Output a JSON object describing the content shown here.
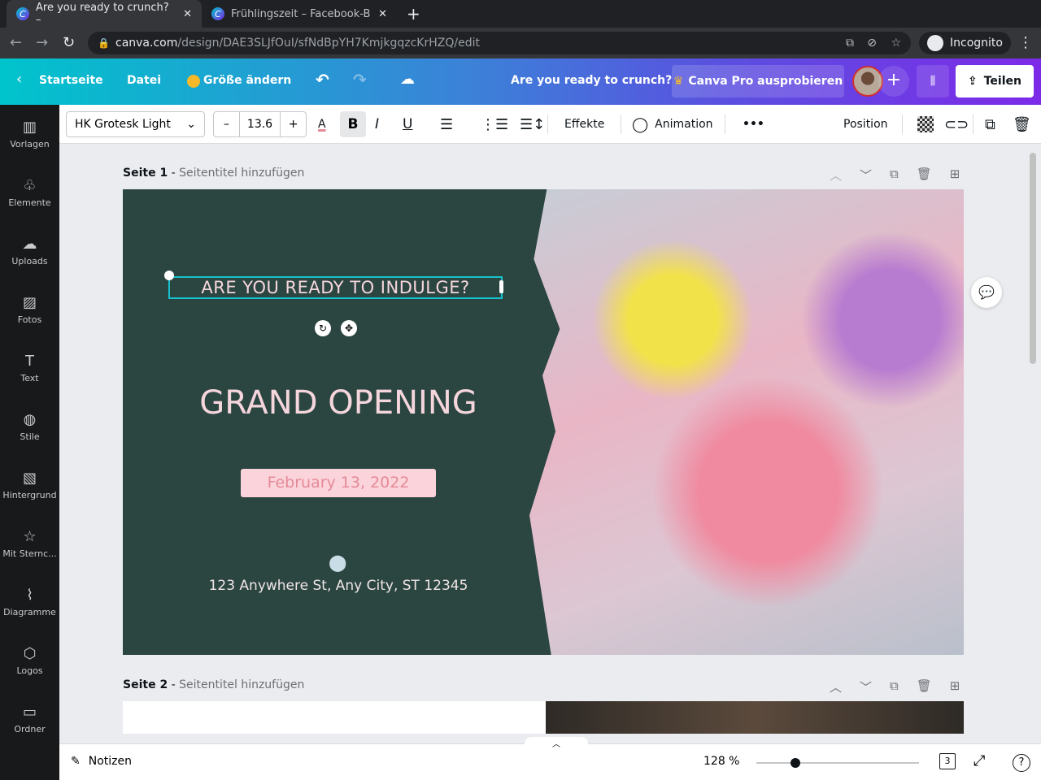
{
  "browser": {
    "tabs": [
      {
        "title": "Are you ready to crunch? –",
        "active": true
      },
      {
        "title": "Frühlingszeit – Facebook-B",
        "active": false
      }
    ],
    "url_host": "canva.com",
    "url_path": "/design/DAE3SLJfOuI/sfNdBpYH7KmjkgqzcKrHZQ/edit",
    "profile": "Incognito"
  },
  "topbar": {
    "home": "Startseite",
    "file": "Datei",
    "resize": "Größe ändern",
    "doc_title": "Are you ready to crunch?",
    "pro": "Canva Pro ausprobieren",
    "share": "Teilen"
  },
  "sidebar": [
    {
      "label": "Vorlagen",
      "icon": "▥"
    },
    {
      "label": "Elemente",
      "icon": "♧"
    },
    {
      "label": "Uploads",
      "icon": "☁"
    },
    {
      "label": "Fotos",
      "icon": "▨"
    },
    {
      "label": "Text",
      "icon": "T"
    },
    {
      "label": "Stile",
      "icon": "◍"
    },
    {
      "label": "Hintergrund",
      "icon": "▧"
    },
    {
      "label": "Mit Sternc...",
      "icon": "☆"
    },
    {
      "label": "Diagramme",
      "icon": "⌇"
    },
    {
      "label": "Logos",
      "icon": "⬡"
    },
    {
      "label": "Ordner",
      "icon": "▭"
    }
  ],
  "toolbar": {
    "font": "HK Grotesk Light",
    "font_size": "13.6",
    "effects": "Effekte",
    "animation": "Animation",
    "position": "Position"
  },
  "pages": [
    {
      "label": "Seite 1",
      "title_placeholder": "Seitentitel hinzufügen"
    },
    {
      "label": "Seite 2",
      "title_placeholder": "Seitentitel hinzufügen"
    }
  ],
  "design": {
    "tagline": "ARE YOU READY TO INDULGE?",
    "headline": "GRAND OPENING",
    "date": "February 13, 2022",
    "address": "123 Anywhere St, Any City, ST 12345"
  },
  "bottom": {
    "notes": "Notizen",
    "zoom": "128 %",
    "zoom_fraction": 0.24,
    "page_count": "3"
  }
}
